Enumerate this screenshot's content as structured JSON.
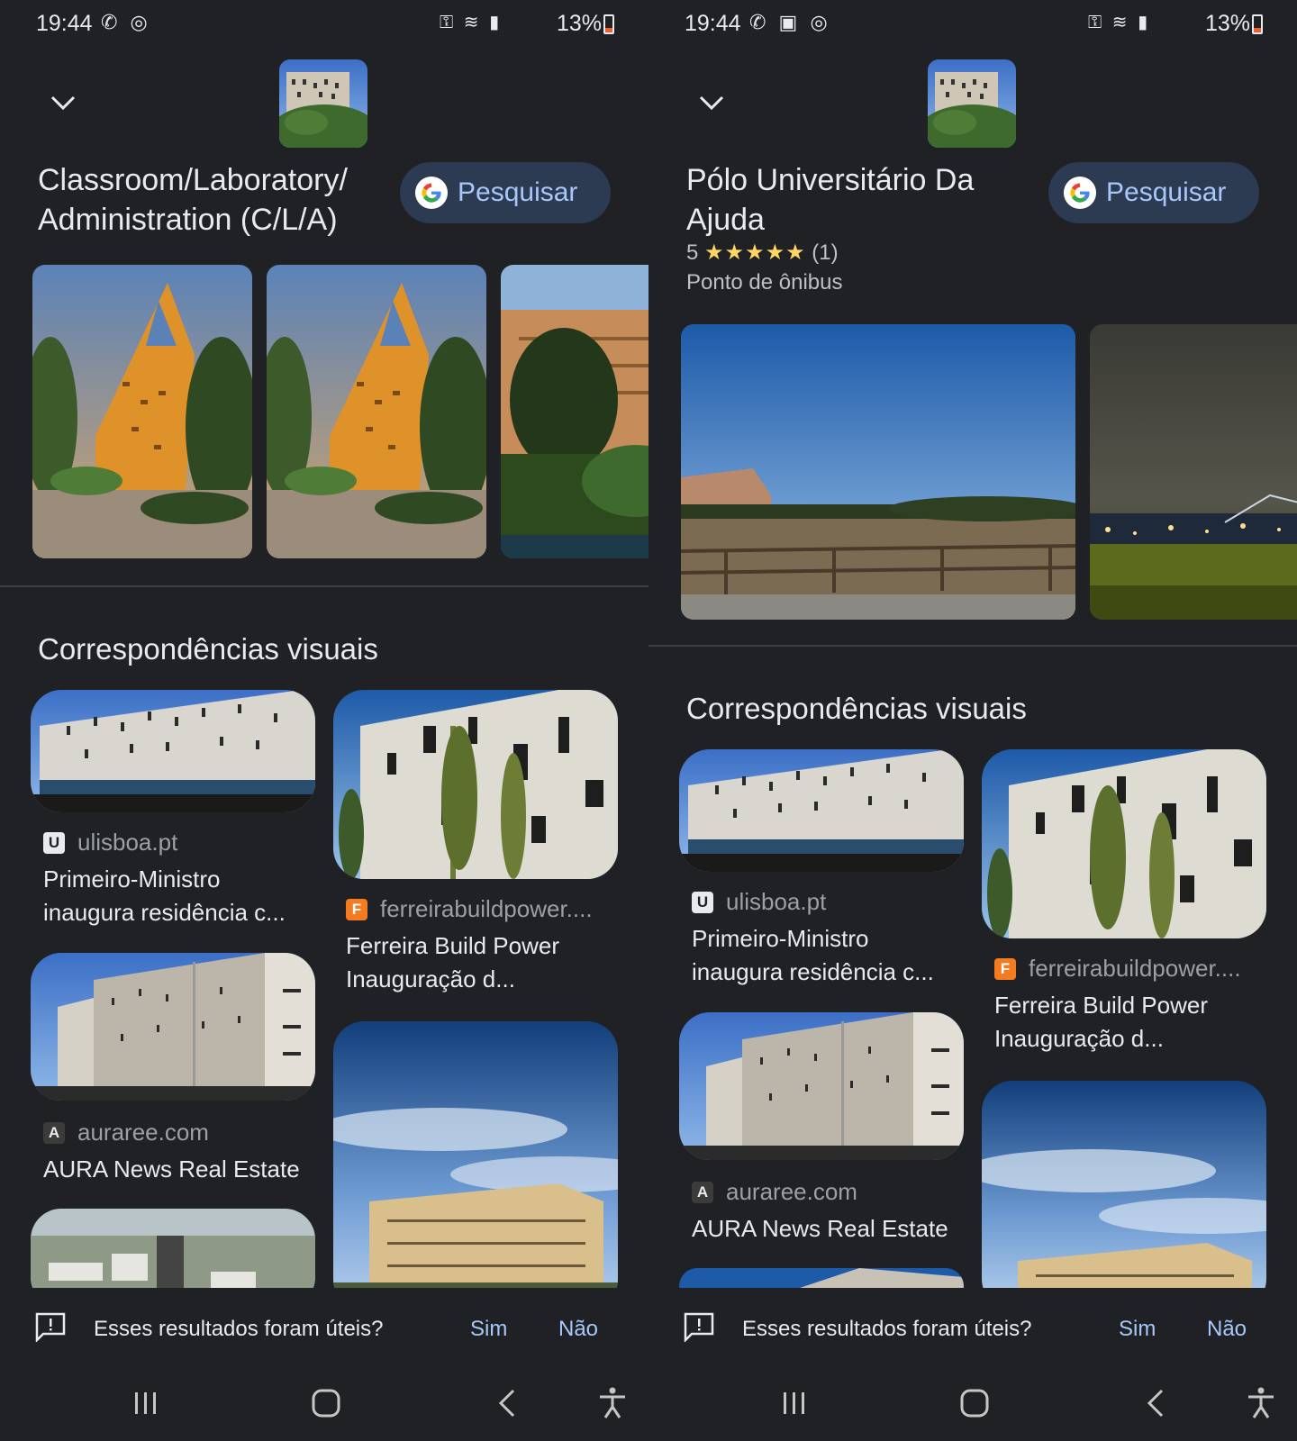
{
  "left": {
    "status": {
      "time": "19:44",
      "battery": "13%"
    },
    "title": "Classroom/Laboratory/ Administration (C/L/A)",
    "search_label": "Pesquisar",
    "section_title": "Correspondências visuais",
    "cards": [
      {
        "source": "ulisboa.pt",
        "favicon": "U",
        "title": "Primeiro-Ministro inaugura residência c..."
      },
      {
        "source": "ferreirabuildpower....",
        "favicon": "F",
        "title": "Ferreira Build Power Inauguração d..."
      },
      {
        "source": "auraree.com",
        "favicon": "A",
        "title": "AURA News Real Estate"
      }
    ],
    "feedback": {
      "question": "Esses resultados foram úteis?",
      "yes": "Sim",
      "no": "Não"
    }
  },
  "right": {
    "status": {
      "time": "19:44",
      "battery": "13%"
    },
    "title": "Pólo Universitário Da Ajuda",
    "rating": {
      "value": "5",
      "stars": "★★★★★",
      "count": "(1)"
    },
    "place_type": "Ponto de ônibus",
    "search_label": "Pesquisar",
    "section_title": "Correspondências visuais",
    "cards": [
      {
        "source": "ulisboa.pt",
        "favicon": "U",
        "title": "Primeiro-Ministro inaugura residência c..."
      },
      {
        "source": "ferreirabuildpower....",
        "favicon": "F",
        "title": "Ferreira Build Power Inauguração d..."
      },
      {
        "source": "auraree.com",
        "favicon": "A",
        "title": "AURA News Real Estate"
      }
    ],
    "feedback": {
      "question": "Esses resultados foram úteis?",
      "yes": "Sim",
      "no": "Não"
    }
  },
  "colors": {
    "background": "#1f2125",
    "accent": "#a8c7fa",
    "button_bg": "#2c3b52",
    "star": "#fdd663"
  },
  "icons": [
    "chevron-down-icon",
    "google-g-icon",
    "feedback-icon",
    "recents-icon",
    "home-icon",
    "back-icon",
    "accessibility-icon",
    "wifi-icon",
    "signal-icon",
    "key-icon",
    "battery-icon"
  ]
}
